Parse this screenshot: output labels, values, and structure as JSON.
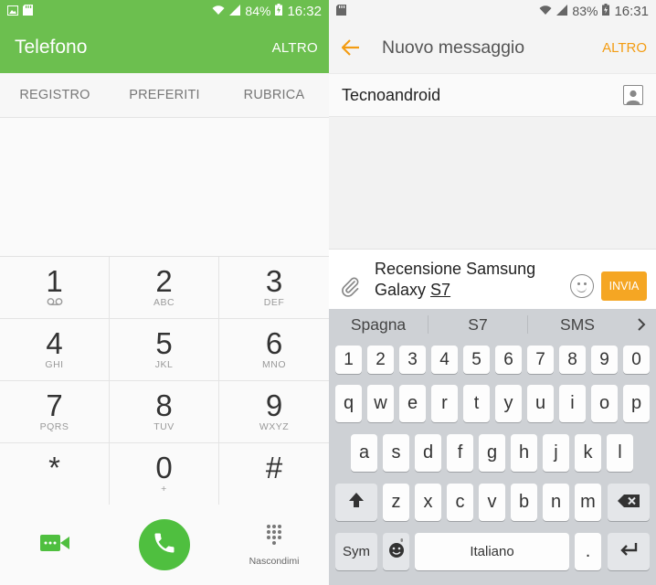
{
  "left": {
    "statusbar": {
      "battery": "84%",
      "time": "16:32"
    },
    "header": {
      "title": "Telefono",
      "more": "ALTRO"
    },
    "tabs": [
      "REGISTRO",
      "PREFERITI",
      "RUBRICA"
    ],
    "keys": [
      {
        "num": "1",
        "sub": ""
      },
      {
        "num": "2",
        "sub": "ABC"
      },
      {
        "num": "3",
        "sub": "DEF"
      },
      {
        "num": "4",
        "sub": "GHI"
      },
      {
        "num": "5",
        "sub": "JKL"
      },
      {
        "num": "6",
        "sub": "MNO"
      },
      {
        "num": "7",
        "sub": "PQRS"
      },
      {
        "num": "8",
        "sub": "TUV"
      },
      {
        "num": "9",
        "sub": "WXYZ"
      },
      {
        "num": "*",
        "sub": ""
      },
      {
        "num": "0",
        "sub": "+"
      },
      {
        "num": "#",
        "sub": ""
      }
    ],
    "actions": {
      "hide_label": "Nascondimi"
    },
    "colors": {
      "accent": "#6cbf4f",
      "call": "#4fbf3f"
    }
  },
  "right": {
    "statusbar": {
      "battery": "83%",
      "time": "16:31"
    },
    "header": {
      "title": "Nuovo messaggio",
      "more": "ALTRO"
    },
    "recipient": "Tecnoandroid",
    "composer": {
      "text_line1": "Recensione Samsung",
      "text_line2_prefix": "Galaxy ",
      "text_line2_underlined": "S7",
      "send": "INVIA"
    },
    "suggestions": [
      "Spagna",
      "S7",
      "SMS"
    ],
    "keyboard": {
      "row_numbers": [
        "1",
        "2",
        "3",
        "4",
        "5",
        "6",
        "7",
        "8",
        "9",
        "0"
      ],
      "row1": [
        "q",
        "w",
        "e",
        "r",
        "t",
        "y",
        "u",
        "i",
        "o",
        "p"
      ],
      "row2": [
        "a",
        "s",
        "d",
        "f",
        "g",
        "h",
        "j",
        "k",
        "l"
      ],
      "row3": [
        "z",
        "x",
        "c",
        "v",
        "b",
        "n",
        "m"
      ],
      "sym": "Sym",
      "space": "Italiano",
      "period": "."
    },
    "colors": {
      "accent": "#f39c12",
      "send": "#f5a623"
    }
  }
}
